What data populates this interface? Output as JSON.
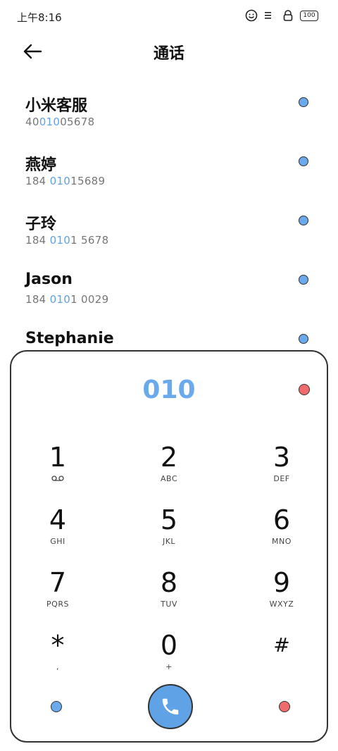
{
  "status_bar": {
    "time": "上午8:16",
    "battery": "100"
  },
  "header": {
    "title": "通话"
  },
  "contacts": [
    {
      "name": "小米客服",
      "pre": "40",
      "hl": "010",
      "post": "05678"
    },
    {
      "name": "燕婷",
      "pre": "184 ",
      "hl": "010",
      "post": "15689"
    },
    {
      "name": "子玲",
      "pre": "184 ",
      "hl": "010",
      "post": "1 5678"
    },
    {
      "name": "Jason",
      "pre": "184 ",
      "hl": "010",
      "post": "1 0029"
    },
    {
      "name": "Stephanie",
      "pre": "",
      "hl": "",
      "post": ""
    }
  ],
  "dialpad": {
    "entered": "010",
    "keys": [
      {
        "num": "1",
        "sub": ""
      },
      {
        "num": "2",
        "sub": "ABC"
      },
      {
        "num": "3",
        "sub": "DEF"
      },
      {
        "num": "4",
        "sub": "GHI"
      },
      {
        "num": "5",
        "sub": "JKL"
      },
      {
        "num": "6",
        "sub": "MNO"
      },
      {
        "num": "7",
        "sub": "PQRS"
      },
      {
        "num": "8",
        "sub": "TUV"
      },
      {
        "num": "9",
        "sub": "WXYZ"
      },
      {
        "num": "*",
        "sub": ","
      },
      {
        "num": "0",
        "sub": "+"
      },
      {
        "num": "#",
        "sub": ""
      }
    ]
  },
  "colors": {
    "accent": "#5fa2e6",
    "delete": "#ef6b6e"
  }
}
